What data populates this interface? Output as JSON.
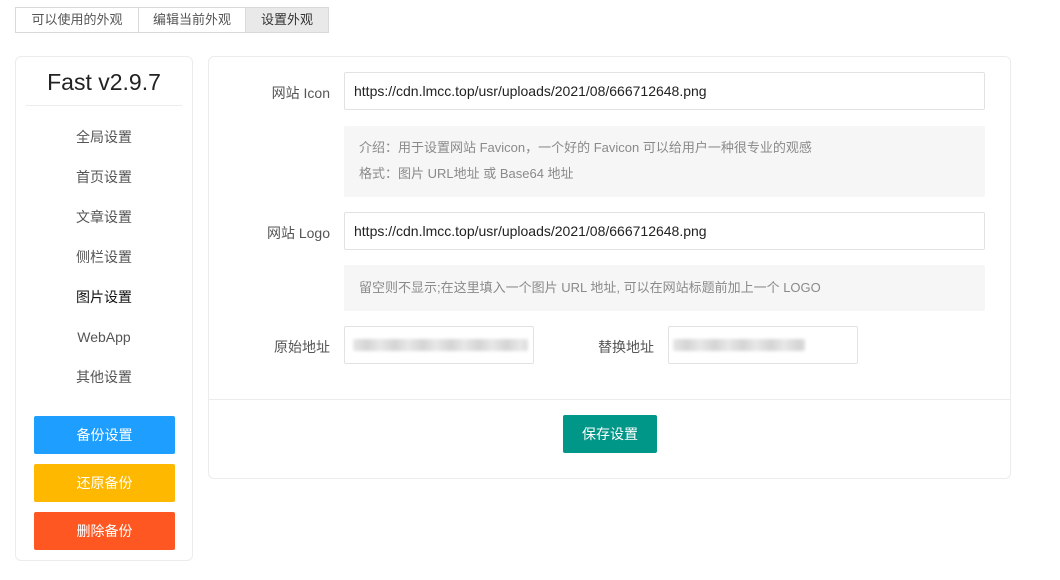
{
  "tabs": [
    {
      "label": "可以使用的外观"
    },
    {
      "label": "编辑当前外观"
    },
    {
      "label": "设置外观"
    }
  ],
  "sidebar": {
    "title": "Fast v2.9.7",
    "items": [
      {
        "label": "全局设置"
      },
      {
        "label": "首页设置"
      },
      {
        "label": "文章设置"
      },
      {
        "label": "侧栏设置"
      },
      {
        "label": "图片设置"
      },
      {
        "label": "WebApp"
      },
      {
        "label": "其他设置"
      }
    ],
    "active_item": "图片设置",
    "buttons": {
      "backup": "备份设置",
      "restore": "还原备份",
      "delete": "删除备份"
    }
  },
  "form": {
    "icon": {
      "label": "网站 Icon",
      "value": "https://cdn.lmcc.top/usr/uploads/2021/08/666712648.png",
      "hint_lines": [
        "介绍：用于设置网站 Favicon，一个好的 Favicon 可以给用户一种很专业的观感",
        "格式：图片 URL地址 或 Base64 地址"
      ]
    },
    "logo": {
      "label": "网站 Logo",
      "value": "https://cdn.lmcc.top/usr/uploads/2021/08/666712648.png",
      "hint": "留空则不显示;在这里填入一个图片 URL 地址, 可以在网站标题前加上一个 LOGO"
    },
    "origin": {
      "label": "原始地址"
    },
    "replace": {
      "label": "替换地址"
    },
    "save_label": "保存设置"
  },
  "colors": {
    "backup_button": "#1e9fff",
    "restore_button": "#ffb800",
    "delete_button": "#ff5722",
    "save_button": "#009688"
  }
}
